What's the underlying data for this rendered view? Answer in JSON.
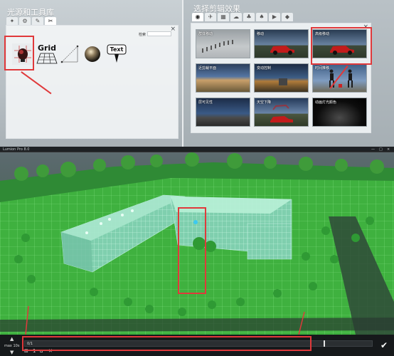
{
  "left_panel": {
    "title": "光源和工具库",
    "tabs": [
      "✦",
      "⚙",
      "✎",
      "✂"
    ],
    "search_label": "检索",
    "close": "×",
    "tools": [
      {
        "name": "light",
        "label": ""
      },
      {
        "name": "grid",
        "label": "Grid"
      },
      {
        "name": "measure",
        "label": ""
      },
      {
        "name": "sphere",
        "label": ""
      },
      {
        "name": "text",
        "label": "Text"
      }
    ]
  },
  "right_panel": {
    "title": "选择剪辑效果",
    "tabs": [
      "◉",
      "✈",
      "▦",
      "☁",
      "♣",
      "♠",
      "▶",
      "◆"
    ],
    "close": "×",
    "effects": [
      {
        "label": "群体移动"
      },
      {
        "label": "移动"
      },
      {
        "label": "高级移动"
      },
      {
        "label": "近剪裁平面"
      },
      {
        "label": "变动控制"
      },
      {
        "label": "时间推移"
      },
      {
        "label": "层可见性"
      },
      {
        "label": "天空下降"
      },
      {
        "label": "动画灯光颜色"
      }
    ]
  },
  "viewport": {
    "app_title": "Lumion Pro 8.0",
    "window_controls": [
      "—",
      "□",
      "×"
    ]
  },
  "timeline": {
    "up": "▲",
    "max_label": "max 10s",
    "down": "▼",
    "start_label": "0/1",
    "controls": [
      "⊞",
      "1",
      "⌂",
      "✕"
    ],
    "ok": "✔"
  },
  "colors": {
    "highlight": "#e0393b",
    "grass": "#3fb13f",
    "glass": "#8fd7b5"
  }
}
